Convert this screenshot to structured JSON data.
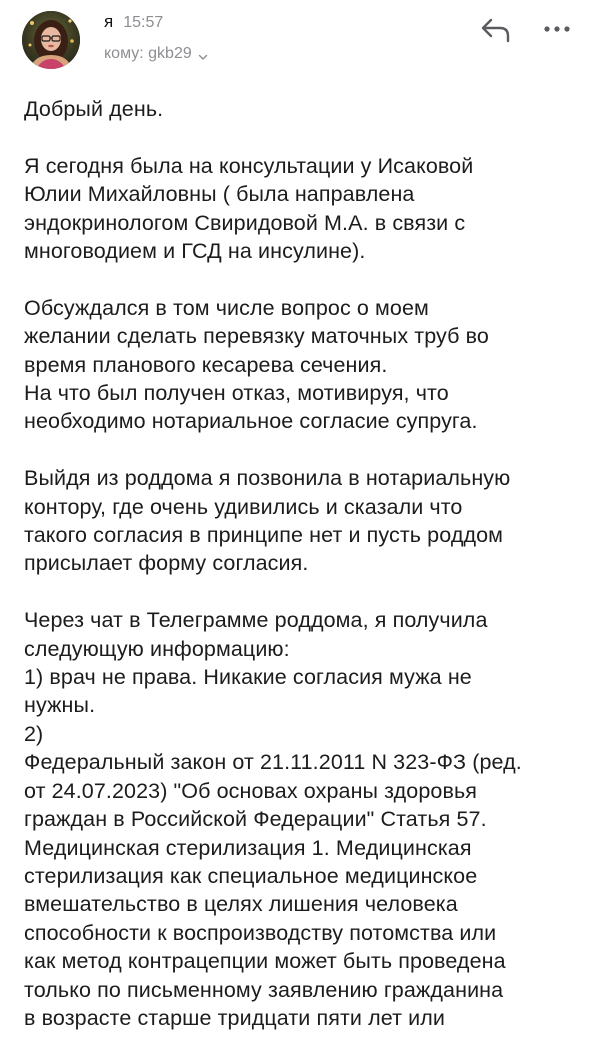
{
  "header": {
    "sender": "я",
    "time": "15:57",
    "recipient": "кому: gkb29",
    "avatar_icon": "avatar-photo",
    "reply_icon": "reply-arrow-icon",
    "more_icon": "more-dots-icon"
  },
  "message": {
    "greeting": "Добрый день.",
    "para1": "Я сегодня была на консультации у Исаковой\nЮлии Михайловны ( была направлена\nэндокринологом Свиридовой М.А. в связи с\nмноговодием и ГСД на инсулине).",
    "para2": "Обсуждался в том числе вопрос о моем\nжелании сделать перевязку маточных труб во\nвремя планового кесарева сечения.\nНа что был получен отказ, мотивируя, что\nнеобходимо нотариальное согласие супруга.",
    "para3": "Выйдя из роддома я позвонила в нотариальную\nконтору, где очень удивились и сказали что\nтакого согласия в принципе нет и пусть роддом\nприсылает форму согласия.",
    "para4": "Через чат в Телеграмме роддома, я получила\nследующую информацию:\n1) врач не права. Никакие согласия мужа не\nнужны.\n2)\nФедеральный закон от 21.11.2011 N 323-ФЗ (ред.\nот 24.07.2023) \"Об основах охраны здоровья\nграждан в Российской Федерации\" Статья 57.\nМедицинская стерилизация 1. Медицинская\nстерилизация как специальное медицинское\nвмешательство в целях лишения человека\nспособности к воспроизводству потомства или\nкак метод контрацепции может быть проведена\nтолько по письменному заявлению гражданина\nв возрасте старше тридцати пяти лет или"
  },
  "colors": {
    "text": "#1c1c1e",
    "secondary": "#8e8e93",
    "background": "#ffffff"
  }
}
